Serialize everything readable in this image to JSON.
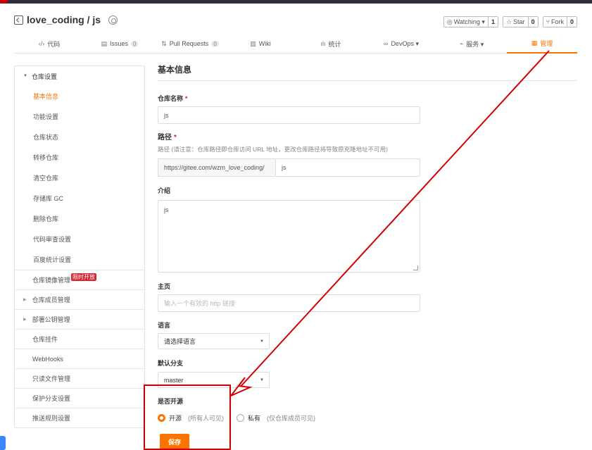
{
  "repo": {
    "title": "love_coding / js",
    "watch_label": "Watching ▾",
    "watch_count": "1",
    "star_label": "Star",
    "star_count": "0",
    "fork_label": "Fork",
    "fork_count": "0"
  },
  "nav": {
    "code": "代码",
    "issues": "Issues",
    "issues_count": "0",
    "pulls": "Pull Requests",
    "pulls_count": "0",
    "wiki": "Wiki",
    "stats": "统计",
    "devops": "DevOps ▾",
    "services": "服务 ▾",
    "manage": "管理"
  },
  "sidebar": {
    "group": "仓库设置",
    "subs": [
      "基本信息",
      "功能设置",
      "仓库状态",
      "转移仓库",
      "清空仓库",
      "存储库 GC",
      "删除仓库",
      "代码审查设置",
      "百度统计设置"
    ],
    "mirror": "仓库镜像管理",
    "mirror_tag": "限时开放",
    "members": "仓库成员管理",
    "deploy_keys": "部署公钥管理",
    "plugins": "仓库挂件",
    "webhooks": "WebHooks",
    "readonly": "只读文件管理",
    "protected": "保护分支设置",
    "push_rules": "推送规则设置"
  },
  "form": {
    "title": "基本信息",
    "name_label": "仓库名称",
    "name_value": "js",
    "path_label": "路径",
    "path_hint": "路径 (请注意：仓库路径即仓库访问 URL 地址，更改仓库路径将导致原克隆地址不可用)",
    "path_prefix": "https://gitee.com/wzm_love_coding/",
    "path_value": "js",
    "desc_label": "介绍",
    "desc_value": "js",
    "home_label": "主页",
    "home_placeholder": "输入一个有效的 http 链接",
    "lang_label": "语言",
    "lang_value": "请选择语言",
    "branch_label": "默认分支",
    "branch_value": "master",
    "open_label": "是否开源",
    "open_option": "开源",
    "open_note": "(所有人可见)",
    "private_option": "私有",
    "private_note": "(仅仓库成员可见)",
    "save": "保存",
    "required_mark": "*"
  },
  "colors": {
    "accent": "#fe7300",
    "annotation": "#d40000"
  }
}
